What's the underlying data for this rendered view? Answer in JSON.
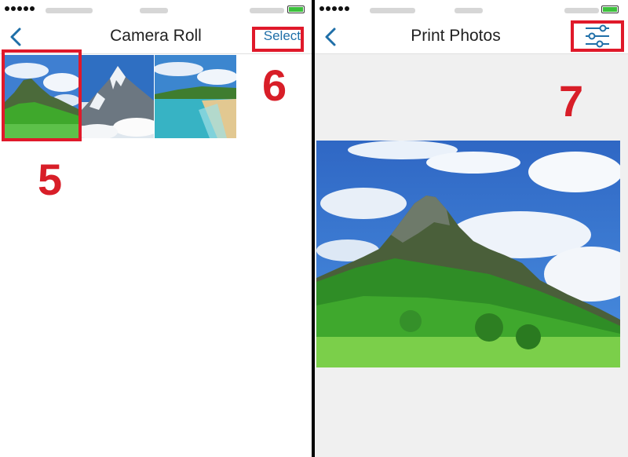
{
  "left_screen": {
    "title": "Camera Roll",
    "back_icon": "chevron-left-icon",
    "select_label": "Select",
    "thumbnails": [
      {
        "name": "mountain-green-photo"
      },
      {
        "name": "snowy-peak-photo"
      },
      {
        "name": "beach-shore-photo"
      }
    ],
    "step_labels": [
      "5",
      "6"
    ]
  },
  "right_screen": {
    "title": "Print Photos",
    "back_icon": "chevron-left-icon",
    "settings_icon": "sliders-icon",
    "step_label": "7"
  },
  "colors": {
    "accent": "#1f6fa8",
    "highlight": "#e0192a",
    "step_number": "#d81e28",
    "battery": "#3cc13c"
  }
}
